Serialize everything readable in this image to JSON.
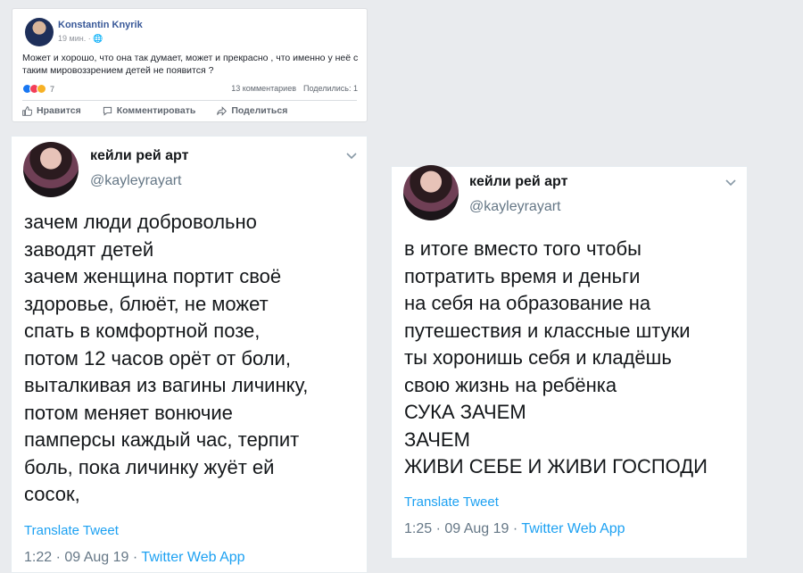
{
  "facebook_post": {
    "author": "Konstantin Knyrik",
    "time": "19 мин. ·",
    "text": "Может и хорошо, что она так думает, может и прекрасно , что именно у неё с таким мировоззрением детей не появится ?",
    "reactions_count": "7",
    "comments": "13 комментариев",
    "shares": "Поделились: 1",
    "actions": {
      "like": "Нравится",
      "comment": "Комментировать",
      "share": "Поделиться"
    }
  },
  "tweets": [
    {
      "name": "кейли рей арт",
      "handle": "@kayleyrayart",
      "text": "зачем люди добровольно\nзаводят детей\nзачем женщина портит своё\nздоровье, блюёт, не может\nспать в комфортной позе,\nпотом 12 часов орёт от боли,\nвыталкивая из вагины личинку,\nпотом меняет вонючие\nпамперсы каждый час, терпит\nболь, пока личинку жуёт ей\nсосок,",
      "translate": "Translate Tweet",
      "timestamp": "1:22 · 09 Aug 19 · ",
      "app": "Twitter Web App"
    },
    {
      "name": "кейли рей арт",
      "handle": "@kayleyrayart",
      "text": "в итоге вместо того чтобы\nпотратить время и деньги\nна себя на образование на\nпутешествия и классные штуки\nты хоронишь себя и кладёшь\nсвою жизнь на ребёнка\nСУКА ЗАЧЕМ\nЗАЧЕМ\nЖИВИ СЕБЕ И ЖИВИ ГОСПОДИ",
      "translate": "Translate Tweet",
      "timestamp": "1:25 · 09 Aug 19 · ",
      "app": "Twitter Web App"
    }
  ]
}
